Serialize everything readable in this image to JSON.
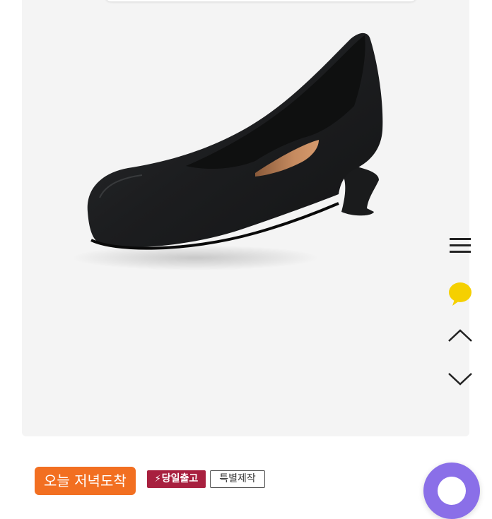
{
  "product": {
    "image": {
      "icon": "black-round-toe-pump-shoe",
      "background": "#f4f4f4"
    }
  },
  "side_controls": {
    "menu_icon": "hamburger-menu-icon",
    "chat_icon": "kakao-speech-bubble-icon",
    "chat_color": "#f5d000",
    "up_icon": "chevron-up-icon",
    "down_icon": "chevron-down-icon"
  },
  "tags": {
    "delivery": "오늘 저녁도착",
    "same_day_icon": "lightning-bolt-icon",
    "same_day": "당일출고",
    "custom": "특별제작",
    "colors": {
      "delivery": "#f26f21",
      "same_day": "#a8203f"
    }
  },
  "chat_fab": {
    "icon": "chat-bubble-icon",
    "color": "#8a6fe8"
  }
}
